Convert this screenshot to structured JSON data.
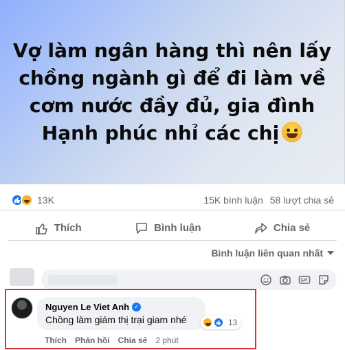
{
  "post": {
    "text_line1": "Vợ làm ngân hàng thì nên lấy",
    "text_line2": "chồng ngành gì để đi làm về",
    "text_line3": "cơm nước đầy đủ, gia đình",
    "text_line4": "Hạnh phúc nhỉ các chị",
    "emoji": "grinning-sweat-emoji"
  },
  "stats": {
    "reaction_count": "13K",
    "comments": "15K bình luận",
    "shares": "58 lượt chia sẻ"
  },
  "actions": {
    "like": "Thích",
    "comment": "Bình luận",
    "share": "Chia sẻ"
  },
  "sort": {
    "label": "Bình luận liên quan nhất"
  },
  "comment": {
    "author": "Nguyen Le Viet Anh",
    "text": "Chồng làm giám thị trại giam nhé",
    "reaction_count": "13",
    "like": "Thích",
    "reply": "Phản hồi",
    "share": "Chia sẻ",
    "time": "2 phút"
  },
  "colors": {
    "accent": "#1877f2",
    "highlight": "#e0302a"
  }
}
